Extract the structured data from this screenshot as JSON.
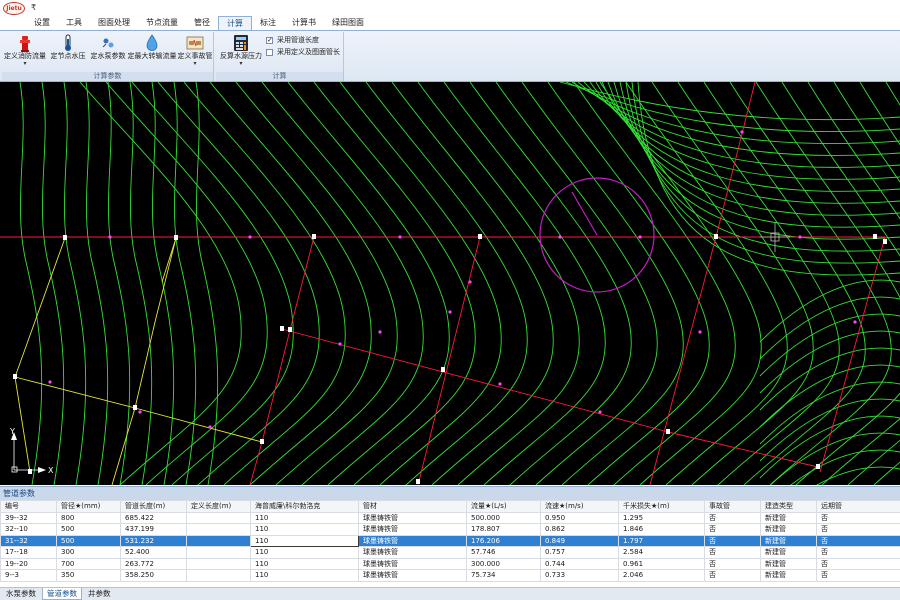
{
  "app": {
    "logo_text": "Jietu",
    "qat_symbol": "₹"
  },
  "menu": {
    "tabs": [
      "设置",
      "工具",
      "图面处理",
      "节点流量",
      "管径",
      "计算",
      "标注",
      "计算书",
      "绿田图面"
    ],
    "active_index": 5
  },
  "ribbon": {
    "group1": {
      "label": "计算参数",
      "buttons": [
        {
          "label": "定义消防流量",
          "icon": "fire-hydrant-icon",
          "has_dropdown": true
        },
        {
          "label": "定节点水压",
          "icon": "thermometer-icon",
          "has_dropdown": false
        },
        {
          "label": "定水泵参数",
          "icon": "pump-icon",
          "has_dropdown": false
        },
        {
          "label": "定最大转输流量",
          "icon": "water-drop-icon",
          "has_dropdown": false
        },
        {
          "label": "定义事故管",
          "icon": "pipe-break-icon",
          "has_dropdown": true
        }
      ]
    },
    "group2": {
      "label": "计算",
      "buttons": [
        {
          "label": "反算水源压力",
          "icon": "calculator-icon",
          "has_dropdown": true
        }
      ],
      "checkboxes": [
        {
          "label": "采用管道长度",
          "checked": true
        },
        {
          "label": "采用定义及图面管长",
          "checked": false
        }
      ]
    }
  },
  "canvas": {
    "background": "#000000",
    "contour_color": "#35e035",
    "pipe_color": "#ff1a3c",
    "pipe_color_yellow": "#e6e63a",
    "marker_color": "#ff44ff",
    "circle_color": "#c020c0",
    "axis_labels": {
      "x": "X",
      "y": "Y"
    }
  },
  "panel": {
    "title": "管道参数",
    "columns": [
      "编号",
      "管径★(mm)",
      "管道长度(m)",
      "定义长度(m)",
      "海曾威廉\\科尔勃洛克",
      "管材",
      "流量★(L/s)",
      "流速★(m/s)",
      "千米损失★(m)",
      "事故管",
      "建造类型",
      "远期管"
    ],
    "rows": [
      [
        "39--32",
        "800",
        "685.422",
        "",
        "110",
        "球墨铸铁管",
        "500.000",
        "0.950",
        "1.295",
        "否",
        "新建管",
        "否"
      ],
      [
        "32--10",
        "500",
        "437.199",
        "",
        "110",
        "球墨铸铁管",
        "178.807",
        "0.862",
        "1.846",
        "否",
        "新建管",
        "否"
      ],
      [
        "31--32",
        "500",
        "531.232",
        "",
        "110",
        "球墨铸铁管",
        "176.206",
        "0.849",
        "1.797",
        "否",
        "新建管",
        "否"
      ],
      [
        "17--18",
        "300",
        "52.400",
        "",
        "110",
        "球墨铸铁管",
        "57.746",
        "0.757",
        "2.584",
        "否",
        "新建管",
        "否"
      ],
      [
        "19--20",
        "700",
        "263.772",
        "",
        "110",
        "球墨铸铁管",
        "300.000",
        "0.744",
        "0.961",
        "否",
        "新建管",
        "否"
      ],
      [
        "9--3",
        "350",
        "358.250",
        "",
        "110",
        "球墨铸铁管",
        "75.734",
        "0.733",
        "2.046",
        "否",
        "新建管",
        "否"
      ]
    ],
    "selected_row": 2
  },
  "bottom_tabs": {
    "items": [
      "水泵参数",
      "管道参数",
      "井参数"
    ],
    "active_index": 1
  }
}
